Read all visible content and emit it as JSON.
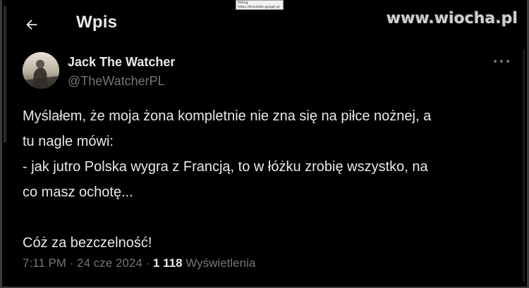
{
  "header": {
    "title": "Wpis",
    "back_icon": "arrow-left-icon"
  },
  "translate_tooltip": {
    "line1": "Pl/Ang",
    "line2": "https://translate.google.pl"
  },
  "watermark": {
    "text": "www.wiocha.pl"
  },
  "author": {
    "name": "Jack The Watcher",
    "handle": "@TheWatcherPL",
    "more_icon": "more-horizontal-icon"
  },
  "tweet": {
    "text": "Myślałem, że moja żona kompletnie nie zna się na piłce nożnej, a\ntu nagle mówi:\n- jak jutro Polska wygra z Francją, to w łóżku zrobię wszystko, na\nco masz ochotę...\n\nCóż za bezczelność!"
  },
  "meta": {
    "time": "7:11 PM",
    "separator1": " · ",
    "date": "24 cze 2024",
    "separator2": " · ",
    "views_count": "1 118",
    "views_label": " Wyświetlenia"
  },
  "colors": {
    "background": "#000000",
    "primary_text": "#e7e9ea",
    "secondary_text": "#71767b"
  }
}
